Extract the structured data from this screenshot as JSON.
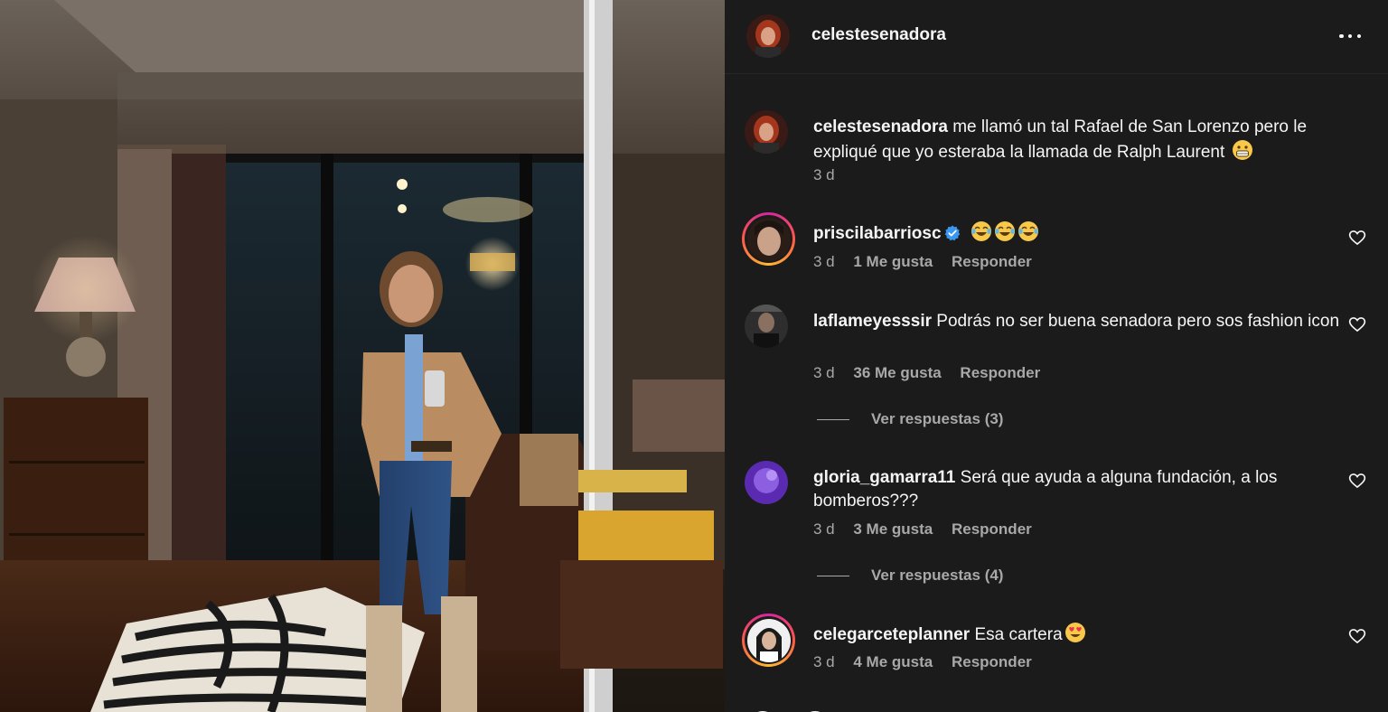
{
  "post": {
    "username": "celestesenadora"
  },
  "caption": {
    "username": "celestesenadora",
    "text": "me llamó un tal Rafael de San Lorenzo pero le expliqué que yo esteraba la llamada de Ralph Laurent",
    "emoji": "grimacing-face",
    "time": "3 d"
  },
  "comments": [
    {
      "username": "priscilabarriosc",
      "verified": true,
      "text": "",
      "emoji": "tears-of-joy x3",
      "time": "3 d",
      "likes": "1 Me gusta",
      "reply_label": "Responder",
      "story_ring": true
    },
    {
      "username": "laflameyesssir",
      "text": "Podrás no ser buena senadora pero sos fashion icon",
      "time": "3 d",
      "likes": "36 Me gusta",
      "reply_label": "Responder",
      "replies_label": "Ver respuestas (3)"
    },
    {
      "username": "gloria_gamarra11",
      "text": "Será que ayuda a alguna fundación, a los bomberos???",
      "time": "3 d",
      "likes": "3 Me gusta",
      "reply_label": "Responder",
      "replies_label": "Ver respuestas (4)"
    },
    {
      "username": "celegarceteplanner",
      "text": "Esa cartera",
      "emoji": "heart-eyes",
      "time": "3 d",
      "likes": "4 Me gusta",
      "reply_label": "Responder",
      "story_ring": true
    }
  ],
  "colors": {
    "panel_bg": "#1b1b1b",
    "text_primary": "#f5f5f5",
    "text_secondary": "#a8a8a8",
    "verified_blue": "#3897f0"
  }
}
